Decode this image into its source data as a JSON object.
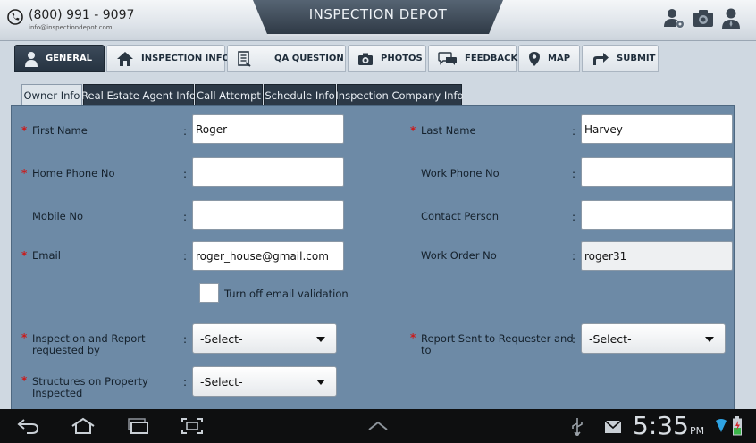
{
  "header": {
    "phone": "(800) 991 - 9097",
    "email": "info@inspectiondepot.com",
    "title": "INSPECTION DEPOT",
    "icons": [
      "user-settings-icon",
      "camera-settings-icon",
      "user-icon"
    ]
  },
  "main_tabs": [
    {
      "label": "GENERAL",
      "icon": "user-icon",
      "active": true
    },
    {
      "label": "INSPECTION INFO",
      "icon": "home-icon",
      "active": false
    },
    {
      "label": "QA QUESTION",
      "icon": "document-icon",
      "active": false
    },
    {
      "label": "PHOTOS",
      "icon": "camera-icon",
      "active": false
    },
    {
      "label": "FEEDBACK",
      "icon": "feedback-icon",
      "active": false
    },
    {
      "label": "MAP",
      "icon": "map-pin-icon",
      "active": false
    },
    {
      "label": "SUBMIT",
      "icon": "share-icon",
      "active": false
    }
  ],
  "sub_tabs": [
    {
      "label": "Owner Info",
      "active": true
    },
    {
      "label": "Real Estate Agent Info",
      "active": false
    },
    {
      "label": "Call Attempt",
      "active": false
    },
    {
      "label": "Schedule Info",
      "active": false
    },
    {
      "label": "Inspection Company Info",
      "active": false
    }
  ],
  "form": {
    "first_name": {
      "label": "First Name",
      "value": "Roger",
      "required": true
    },
    "last_name": {
      "label": "Last Name",
      "value": "Harvey",
      "required": true
    },
    "home_phone": {
      "label": "Home Phone No",
      "value": "",
      "required": true
    },
    "work_phone": {
      "label": "Work Phone No",
      "value": "",
      "required": false
    },
    "mobile": {
      "label": "Mobile No",
      "value": "",
      "required": false
    },
    "contact_person": {
      "label": "Contact Person",
      "value": "",
      "required": false
    },
    "email": {
      "label": "Email",
      "value": "roger_house@gmail.com",
      "required": true
    },
    "work_order": {
      "label": "Work Order No",
      "value": "roger31",
      "required": false
    },
    "email_validation": {
      "label": "Turn off email validation",
      "checked": false
    },
    "inspection_report": {
      "label_line1": "Inspection and Report",
      "label_line2": "requested by",
      "value": "-Select-",
      "required": true
    },
    "report_sent": {
      "label_line1": "Report Sent to Requester and",
      "label_line2": "to",
      "value": "-Select-",
      "required": true
    },
    "structures": {
      "label_line1": "Structures on Property",
      "label_line2": "Inspected",
      "value": "-Select-",
      "required": true
    },
    "colon": ":",
    "asterisk": "*"
  },
  "system_bar": {
    "time": "5:35",
    "ampm": "PM",
    "icons": [
      "back-icon",
      "home-icon",
      "recent-apps-icon",
      "screenshot-icon",
      "expand-icon",
      "usb-icon",
      "email-icon",
      "wifi-icon",
      "battery-icon"
    ]
  },
  "colors": {
    "panel": "#6d8aa6",
    "active_tab": "#2c3947",
    "required": "#cc1a1a"
  }
}
